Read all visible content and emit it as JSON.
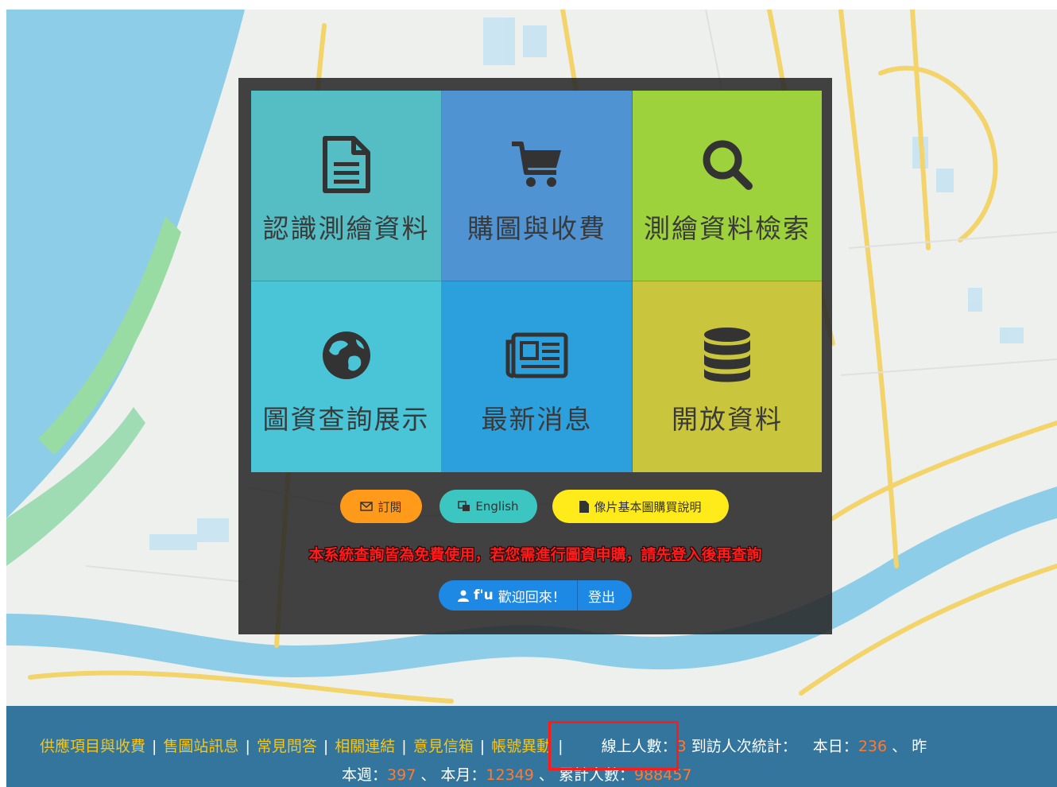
{
  "tiles": [
    {
      "label": "認識測繪資料",
      "icon": "document-icon"
    },
    {
      "label": "購圖與收費",
      "icon": "cart-icon"
    },
    {
      "label": "測繪資料檢索",
      "icon": "search-icon"
    },
    {
      "label": "圖資查詢展示",
      "icon": "globe-icon"
    },
    {
      "label": "最新消息",
      "icon": "newspaper-icon"
    },
    {
      "label": "開放資料",
      "icon": "database-icon"
    }
  ],
  "buttons": {
    "subscribe": "訂閱",
    "english": "English",
    "guide": "像片基本圖購買說明"
  },
  "notice": "本系統查詢皆為免費使用，若您需進行圖資申購，請先登入後再查詢",
  "user": {
    "name": "f'u",
    "welcome": "歡迎回來！",
    "logout": "登出"
  },
  "footer": {
    "links": [
      "供應項目與收費",
      "售圖站訊息",
      "常見問答",
      "相關連結",
      "意見信箱",
      "帳號異動"
    ],
    "online_label": "線上人數：",
    "online_count": "3",
    "visits_label": "到訪人次統計：",
    "today_label": "本日：",
    "today_count": "236",
    "sep": "、",
    "cut_text": "昨",
    "week_label": "本週：",
    "week_count": "397",
    "month_label": "本月：",
    "month_count": "12349",
    "total_label": "累計人數：",
    "total_count": "988457"
  },
  "colors": {
    "tile1": "#54bec4",
    "tile2": "#4f93d3",
    "tile3": "#9ed23c",
    "tile4": "#49c5d7",
    "tile5": "#2ba0dc",
    "tile6": "#c9c63e",
    "footer_link": "#f5c518",
    "footer_number": "#ff7a33",
    "notice": "#ff1c1c"
  }
}
